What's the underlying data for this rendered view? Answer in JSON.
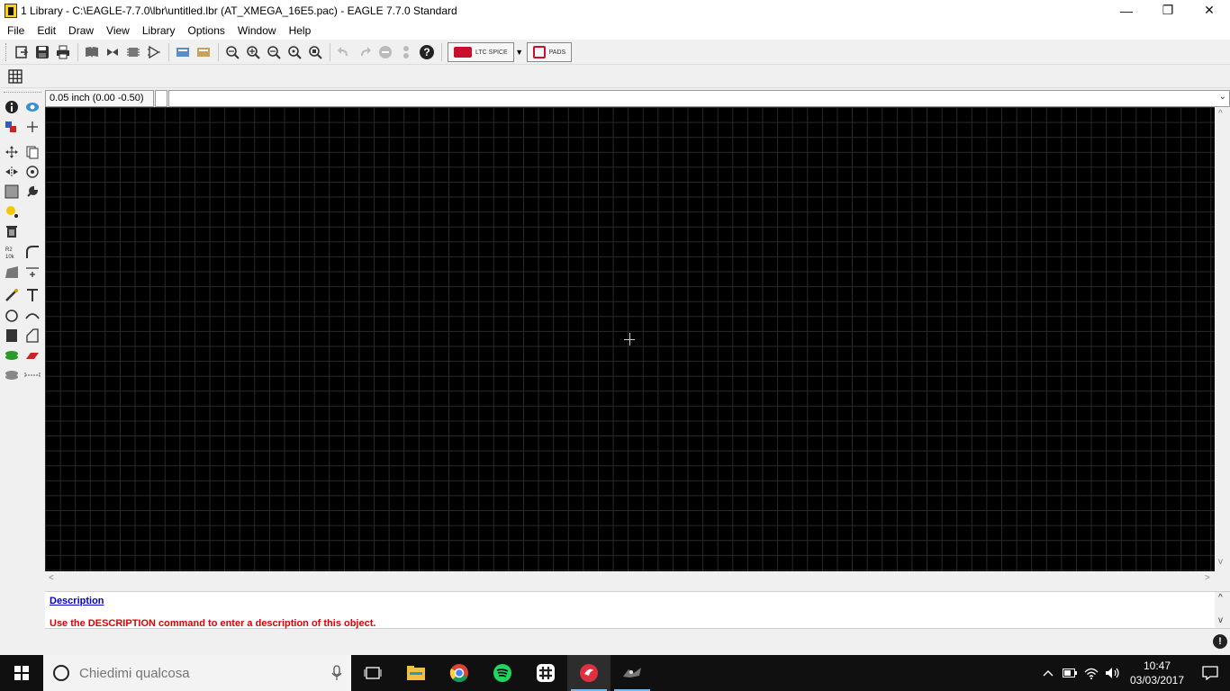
{
  "window": {
    "title": "1 Library - C:\\EAGLE-7.7.0\\lbr\\untitled.lbr (AT_XMEGA_16E5.pac) - EAGLE 7.7.0 Standard",
    "minimize": "—",
    "maximize": "❐",
    "close": "✕"
  },
  "menu": [
    {
      "label": "File"
    },
    {
      "label": "Edit"
    },
    {
      "label": "Draw"
    },
    {
      "label": "View"
    },
    {
      "label": "Library"
    },
    {
      "label": "Options"
    },
    {
      "label": "Window"
    },
    {
      "label": "Help"
    }
  ],
  "toolbar": {
    "ltc_label": "LTC SPICE",
    "pads_label": "PADS"
  },
  "coord": {
    "grid_readout": "0.05 inch (0.00 -0.50)",
    "command_value": ""
  },
  "description": {
    "heading": "Description",
    "text": "Use the DESCRIPTION command to enter a description of this object."
  },
  "status": {
    "stop": "!"
  },
  "taskbar": {
    "search_placeholder": "Chiedimi qualcosa",
    "time": "10:47",
    "date": "03/03/2017"
  },
  "colors": {
    "canvas_bg": "#000000",
    "grid_line": "#2a2a2a",
    "description_link": "#0000cc",
    "description_text": "#e00000"
  }
}
